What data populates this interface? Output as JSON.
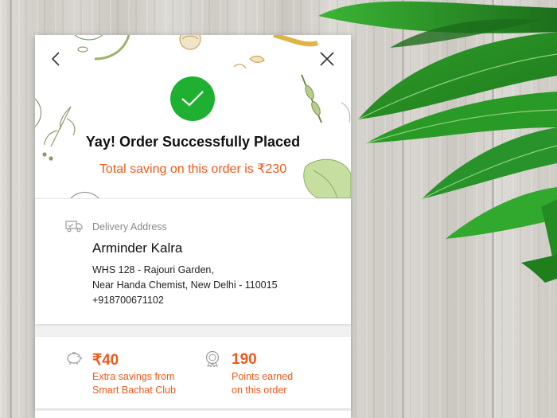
{
  "header": {
    "back_icon": "chevron-left-icon",
    "close_icon": "close-icon"
  },
  "success": {
    "icon": "checkmark-icon",
    "title": "Yay! Order Successfully Placed",
    "saving_text": "Total saving on this order is ₹230",
    "accent_color": "#1fb032",
    "saving_color": "#ef5a1c"
  },
  "address": {
    "icon": "delivery-truck-icon",
    "label": "Delivery Address",
    "name": "Arminder Kalra",
    "line1": "WHS 128 - Rajouri Garden,",
    "line2": "Near Handa Chemist, New Delhi - 110015",
    "phone": "+918700671102"
  },
  "rewards": {
    "savings": {
      "icon": "piggy-bank-icon",
      "value": "₹40",
      "line1": "Extra savings from",
      "line2": "Smart Bachat Club"
    },
    "points": {
      "icon": "medal-icon",
      "value": "190",
      "line1": "Points earned",
      "line2": "on this order"
    }
  }
}
